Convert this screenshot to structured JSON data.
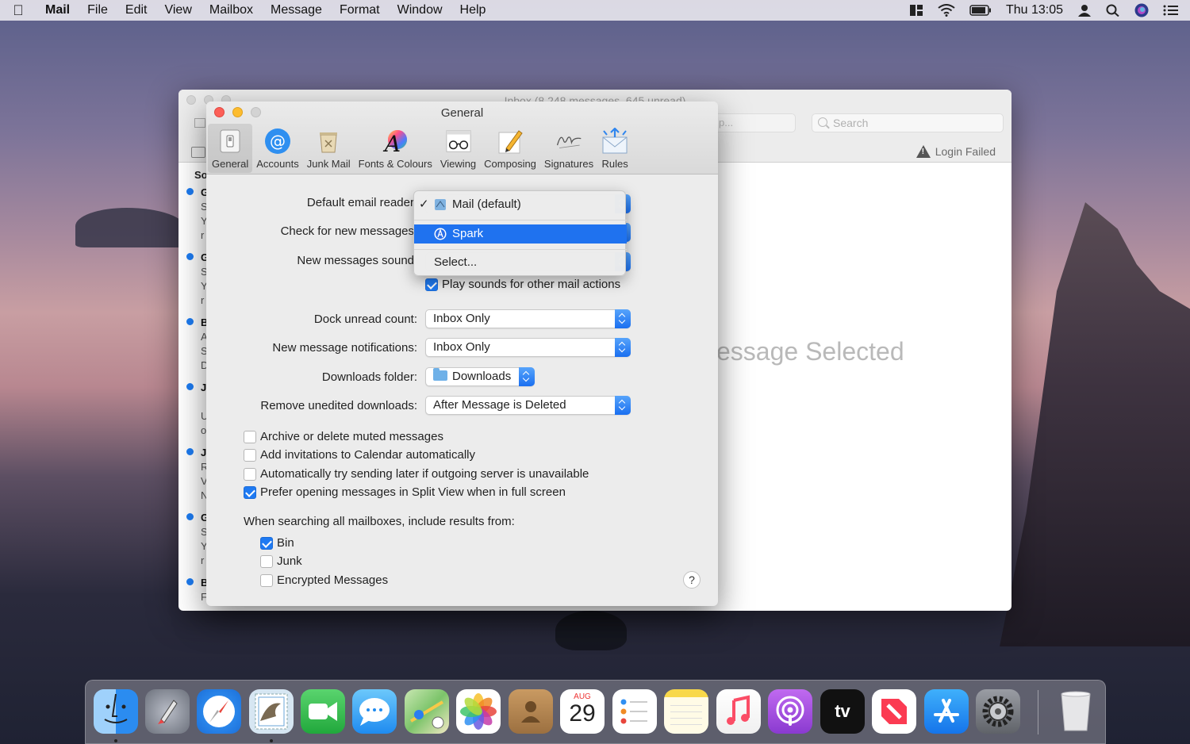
{
  "menubar": {
    "app": "Mail",
    "menus": [
      "File",
      "Edit",
      "View",
      "Mailbox",
      "Message",
      "Format",
      "Window",
      "Help"
    ],
    "clock": "Thu 13:05"
  },
  "mail_window": {
    "title": "Inbox (8,248 messages, 645 unread)",
    "search_placeholder": "Search",
    "field2_text": "p...",
    "login_failed": "Login Failed",
    "no_message": "essage Selected",
    "sort_label": "So",
    "list_letters": [
      [
        "G",
        "S",
        "Y",
        "r"
      ],
      [
        "G",
        "S",
        "Y",
        "r"
      ],
      [
        "B",
        "A",
        "S",
        "D"
      ],
      [
        "J",
        "",
        "U",
        "o"
      ],
      [
        "J",
        "R",
        "V",
        "N"
      ],
      [
        "G",
        "S",
        "Y",
        "r"
      ],
      [
        "B",
        "F"
      ]
    ]
  },
  "prefs": {
    "title": "General",
    "tabs": [
      {
        "label": "General",
        "icon": "switch-icon"
      },
      {
        "label": "Accounts",
        "icon": "at-sign-icon"
      },
      {
        "label": "Junk Mail",
        "icon": "junk-bin-icon"
      },
      {
        "label": "Fonts & Colours",
        "icon": "font-icon"
      },
      {
        "label": "Viewing",
        "icon": "glasses-icon"
      },
      {
        "label": "Composing",
        "icon": "pencil-icon"
      },
      {
        "label": "Signatures",
        "icon": "signature-icon"
      },
      {
        "label": "Rules",
        "icon": "rules-envelope-icon"
      }
    ],
    "default_reader_label": "Default email reader",
    "check_new_label": "Check for new messages",
    "new_sound_label": "New messages sound",
    "play_sounds_label": "Play sounds for other mail actions",
    "play_sounds_checked": true,
    "dock_unread_label": "Dock unread count:",
    "dock_unread_value": "Inbox Only",
    "notifications_label": "New message notifications:",
    "notifications_value": "Inbox Only",
    "downloads_label": "Downloads folder:",
    "downloads_value": "Downloads",
    "remove_label": "Remove unedited downloads:",
    "remove_value": "After Message is Deleted",
    "options": [
      {
        "label": "Archive or delete muted messages",
        "checked": false
      },
      {
        "label": "Add invitations to Calendar automatically",
        "checked": false
      },
      {
        "label": "Automatically try sending later if outgoing server is unavailable",
        "checked": false
      },
      {
        "label": "Prefer opening messages in Split View when in full screen",
        "checked": true
      }
    ],
    "search_heading": "When searching all mailboxes, include results from:",
    "search_sources": [
      {
        "label": "Bin",
        "checked": true
      },
      {
        "label": "Junk",
        "checked": false
      },
      {
        "label": "Encrypted Messages",
        "checked": false
      }
    ],
    "help": "?"
  },
  "dropdown": {
    "check_mark": "✓",
    "items": [
      "Mail (default)",
      "Spark",
      "Select..."
    ],
    "selected": "Spark"
  },
  "dock": {
    "apps": [
      {
        "name": "Finder",
        "icon": "finder-icon",
        "color": "#3c9cf0",
        "running": true
      },
      {
        "name": "Launchpad",
        "icon": "launchpad-icon",
        "color": "#8a8f9a",
        "running": false
      },
      {
        "name": "Safari",
        "icon": "safari-icon",
        "color": "#2f8ff2",
        "running": false
      },
      {
        "name": "Mail",
        "icon": "mail-stamp-icon",
        "color": "#6aa6d8",
        "running": true
      },
      {
        "name": "FaceTime",
        "icon": "facetime-icon",
        "color": "#30c24c",
        "running": false
      },
      {
        "name": "Messages",
        "icon": "messages-icon",
        "color": "#34a8f5",
        "running": false
      },
      {
        "name": "Maps",
        "icon": "maps-icon",
        "color": "#7cc46a",
        "running": false
      },
      {
        "name": "Photos",
        "icon": "photos-icon",
        "color": "#f2f2f2",
        "running": false
      },
      {
        "name": "Contacts",
        "icon": "contacts-icon",
        "color": "#b98a55",
        "running": false
      },
      {
        "name": "Calendar",
        "icon": "calendar-icon",
        "color": "#ffffff",
        "running": false,
        "month": "AUG",
        "day": "29"
      },
      {
        "name": "Reminders",
        "icon": "reminders-icon",
        "color": "#ffffff",
        "running": false
      },
      {
        "name": "Notes",
        "icon": "notes-icon",
        "color": "#fdf3b0",
        "running": false
      },
      {
        "name": "Music",
        "icon": "music-icon",
        "color": "#fb4d66",
        "running": false
      },
      {
        "name": "Podcasts",
        "icon": "podcasts-icon",
        "color": "#a454e3",
        "running": false
      },
      {
        "name": "TV",
        "icon": "tv-icon",
        "color": "#111111",
        "running": false,
        "text": "tv"
      },
      {
        "name": "News",
        "icon": "news-icon",
        "color": "#fb3b52",
        "running": false
      },
      {
        "name": "App Store",
        "icon": "app-store-icon",
        "color": "#1c8ef5",
        "running": false
      },
      {
        "name": "System Preferences",
        "icon": "gear-icon",
        "color": "#7c7f86",
        "running": false
      },
      {
        "name": "Trash",
        "icon": "trash-icon",
        "color": "#e6e6e8",
        "running": false
      }
    ]
  }
}
